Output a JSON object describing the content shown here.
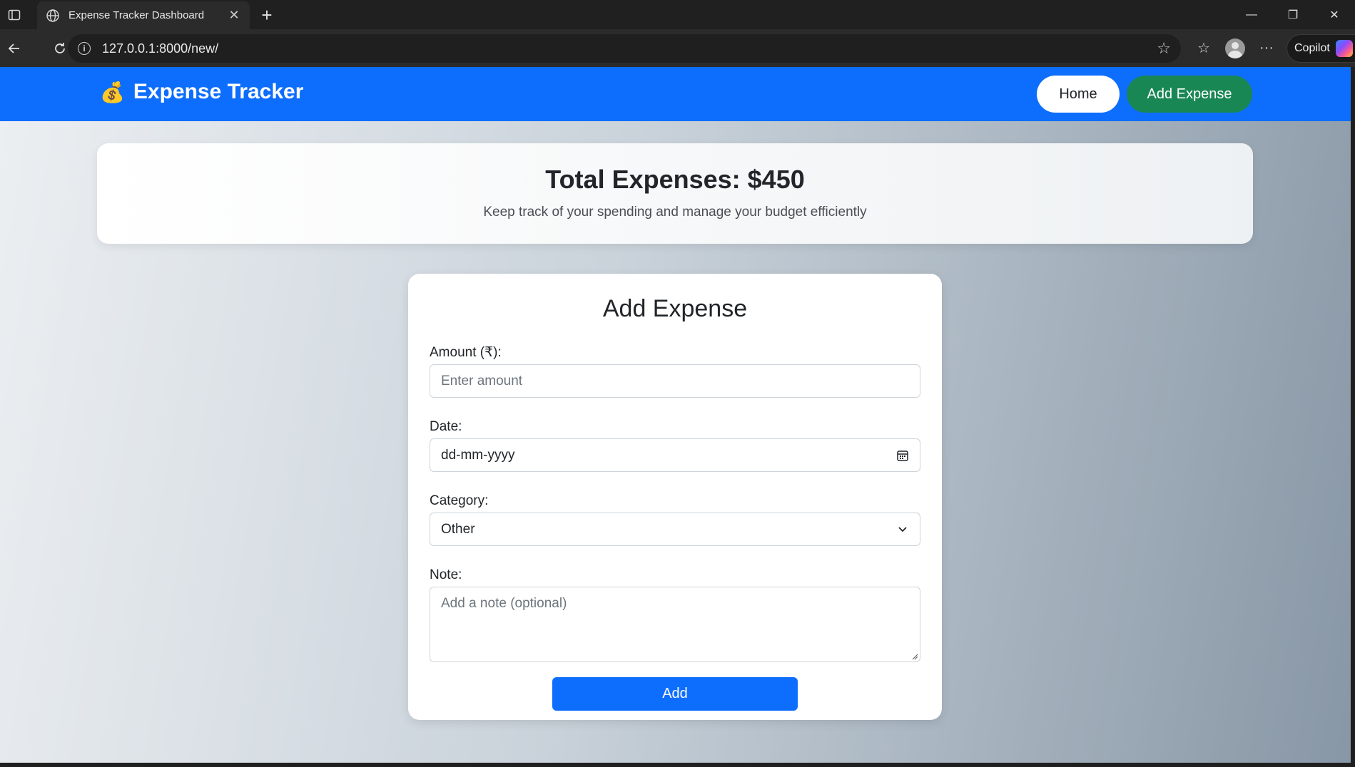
{
  "browser": {
    "tab_title": "Expense Tracker Dashboard",
    "url": "127.0.0.1:8000/new/",
    "copilot_label": "Copilot",
    "icons": [
      "sidebar-icon",
      "globe-icon",
      "close-icon",
      "plus-icon",
      "minimize-icon",
      "restore-icon",
      "window-close-icon",
      "back-icon",
      "reload-icon",
      "info-icon",
      "star-icon",
      "favorites-icon",
      "profile-icon",
      "more-icon",
      "copilot-icon"
    ]
  },
  "navbar": {
    "brand_icon": "💰",
    "brand": "Expense Tracker",
    "home_label": "Home",
    "add_label": "Add Expense",
    "colors": {
      "bar": "#0d6efd",
      "home": "#ffffff",
      "add": "#198754"
    }
  },
  "summary": {
    "title": "Total Expenses: $450",
    "subtitle": "Keep track of your spending and manage your budget efficiently"
  },
  "form": {
    "title": "Add Expense",
    "amount_label": "Amount (₹):",
    "amount_placeholder": "Enter amount",
    "date_label": "Date:",
    "date_placeholder": "dd-mm-yyyy",
    "category_label": "Category:",
    "category_value": "Other",
    "note_label": "Note:",
    "note_placeholder": "Add a note (optional)",
    "submit_label": "Add"
  }
}
